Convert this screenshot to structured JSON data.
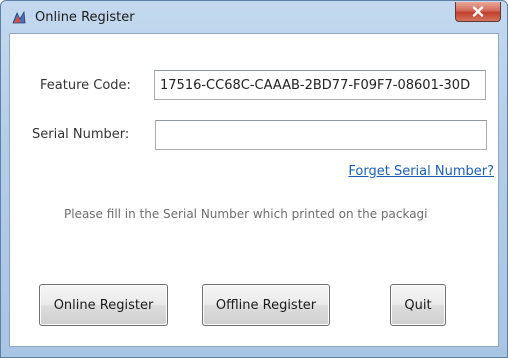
{
  "window": {
    "title": "Online Register"
  },
  "form": {
    "feature_code_label": "Feature Code:",
    "feature_code_value": "17516-CC68C-CAAAB-2BD77-F09F7-08601-30D",
    "serial_number_label": "Serial Number:",
    "serial_number_value": "",
    "forget_link": "Forget Serial Number?",
    "hint": "Please fill in the Serial Number which printed on the packagi"
  },
  "buttons": {
    "online_register": "Online Register",
    "offline_register": "Offline Register",
    "quit": "Quit"
  },
  "icons": {
    "app_icon": "register-app-icon",
    "close_icon": "close-icon"
  },
  "colors": {
    "link": "#1a5fb4",
    "titlebar": "#b3cde9",
    "close_button": "#c0402c"
  }
}
